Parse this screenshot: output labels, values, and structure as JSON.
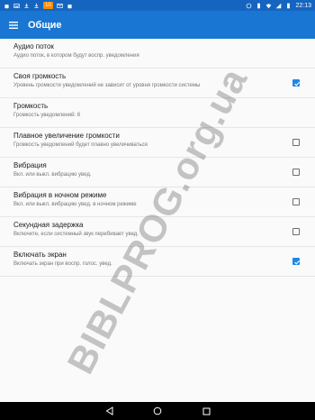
{
  "status_bar": {
    "notification_count": "10",
    "time": "22:13"
  },
  "toolbar": {
    "title": "Общие"
  },
  "settings": [
    {
      "title": "Аудио поток",
      "subtitle": "Аудио поток, в котором будут воспр. уведомления"
    },
    {
      "title": "Своя громкость",
      "subtitle": "Уровень громкости уведомлений не зависит от уровня громкости системы",
      "checked": true
    },
    {
      "title": "Громкость",
      "subtitle": "Громкость уведомлений: 8"
    },
    {
      "title": "Плавное увеличение громкости",
      "subtitle": "Громкость уведомлений будет плавно увеличиваться",
      "checked": false
    },
    {
      "title": "Вибрация",
      "subtitle": "Вкл. или выкл. вибрацию увед.",
      "checked": false
    },
    {
      "title": "Вибрация в ночном режиме",
      "subtitle": "Вкл. или выкл. вибрацию увед. в ночном режиме",
      "checked": false
    },
    {
      "title": "Секундная задержка",
      "subtitle": "Включите, если системный звук перебивает увед.",
      "checked": false
    },
    {
      "title": "Включать экран",
      "subtitle": "Включать экран при воспр. голос. увед.",
      "checked": true
    }
  ],
  "watermark": "BIBLPROG.org.ua",
  "colors": {
    "toolbar": "#1976d2",
    "status_bar": "#1565c0",
    "checkbox_on": "#1e88e5"
  }
}
